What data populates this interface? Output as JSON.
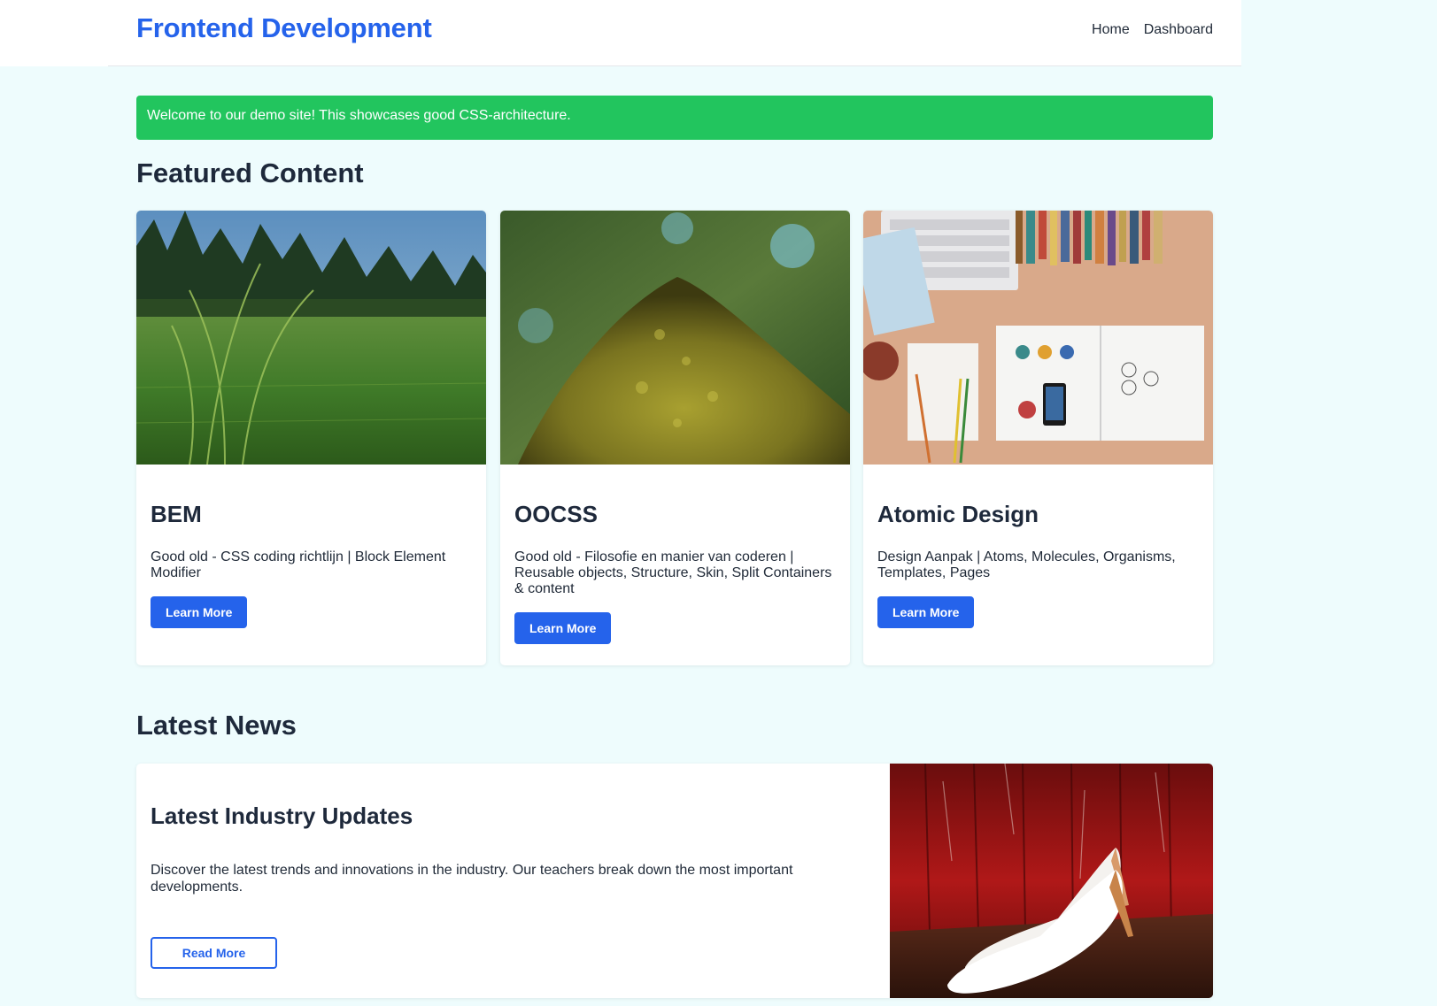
{
  "header": {
    "brand": "Frontend Development",
    "nav": [
      {
        "label": "Home"
      },
      {
        "label": "Dashboard"
      }
    ]
  },
  "alert": {
    "message": "Welcome to our demo site! This showcases good CSS-architecture."
  },
  "featured": {
    "title": "Featured Content",
    "cards": [
      {
        "image": "grass-field-photo",
        "title": "BEM",
        "text": "Good old - CSS coding richtlijn | Block Element Modifier",
        "button": "Learn More"
      },
      {
        "image": "mossy-tree-trunk-photo",
        "title": "OOCSS",
        "text": "Good old - Filosofie en manier van coderen | Reusable objects, Structure, Skin, Split Containers & content",
        "button": "Learn More"
      },
      {
        "image": "desk-workspace-photo",
        "title": "Atomic Design",
        "text": "Design Aanpak | Atoms, Molecules, Organisms, Templates, Pages",
        "button": "Learn More"
      }
    ]
  },
  "news": {
    "section_title": "Latest News",
    "title": "Latest Industry Updates",
    "text": "Discover the latest trends and innovations in the industry. Our teachers break down the most important developments.",
    "button": "Read More",
    "image": "white-heels-on-red-photo"
  },
  "colors": {
    "brand": "#2563eb",
    "alert": "#22c55e",
    "page_bg": "#eefcfd",
    "heading": "#1e293b"
  }
}
